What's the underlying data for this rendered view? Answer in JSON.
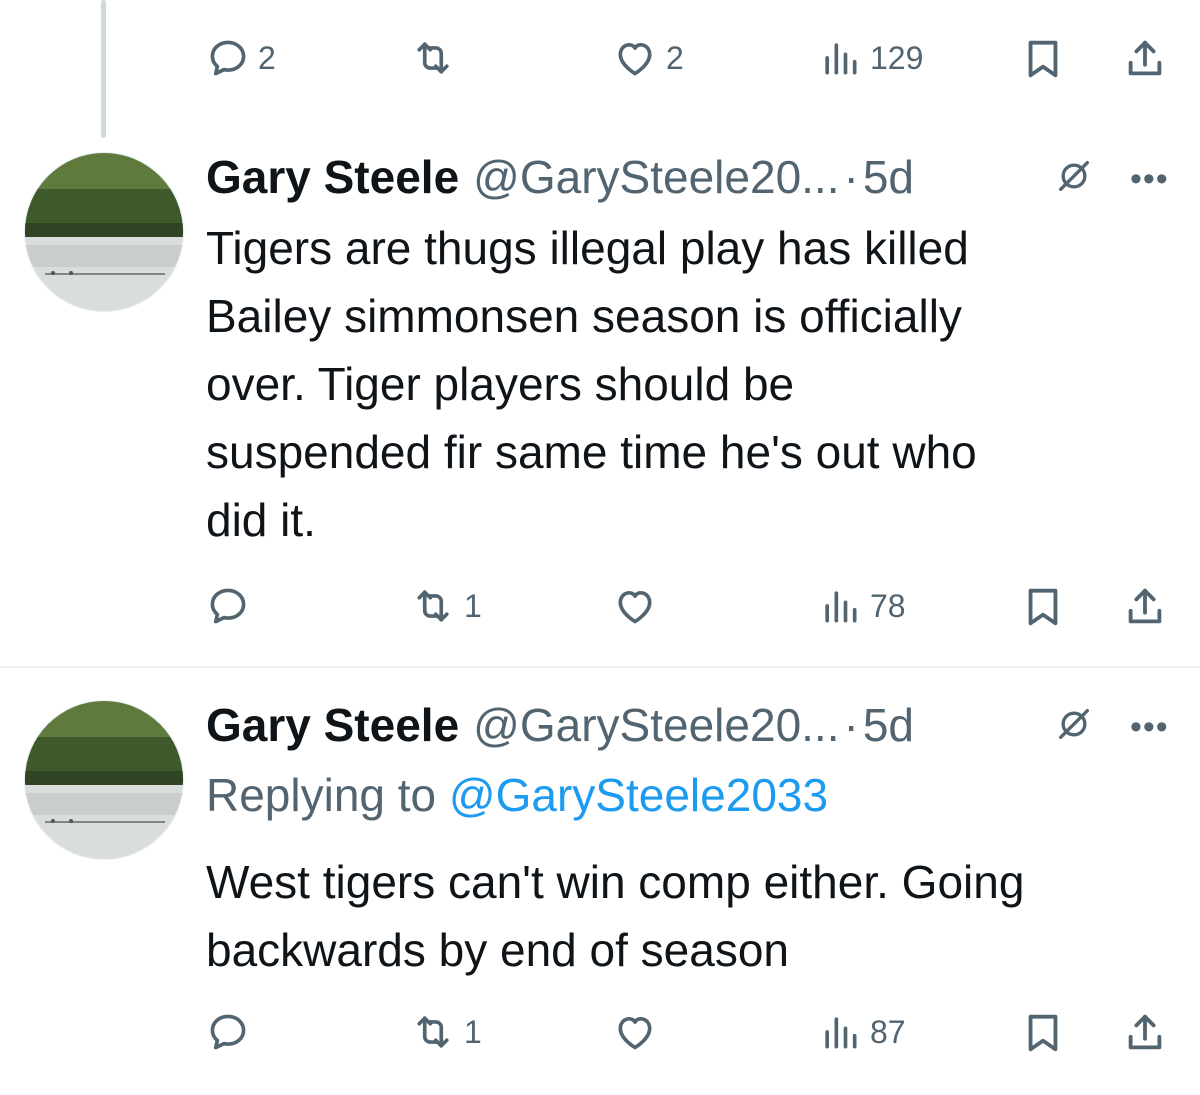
{
  "top_actions": {
    "replies": "2",
    "reposts": "",
    "likes": "2",
    "views": "129"
  },
  "tweets": [
    {
      "name": "Gary Steele",
      "handle": "@GarySteele20...",
      "separator": "·",
      "time": "5d",
      "replying_prefix": "",
      "replying_handle": "",
      "lines": [
        "Tigers are thugs illegal play has killed",
        "Bailey  simmonsen season is officially",
        "over. Tiger players should  be",
        "suspended  fir same time he's out who",
        "did it."
      ],
      "actions": {
        "replies": "",
        "reposts": "1",
        "likes": "",
        "views": "78"
      }
    },
    {
      "name": "Gary Steele",
      "handle": "@GarySteele20...",
      "separator": "·",
      "time": "5d",
      "replying_prefix": "Replying to ",
      "replying_handle": "@GarySteele2033",
      "lines": [
        "West tigers can't win comp either.  Going",
        "backwards  by end of season"
      ],
      "actions": {
        "replies": "",
        "reposts": "1",
        "likes": "",
        "views": "87"
      }
    }
  ],
  "icons": {
    "reply": "reply-icon",
    "repost": "repost-icon",
    "like": "heart-icon",
    "views": "views-icon",
    "bookmark": "bookmark-icon",
    "share": "share-icon",
    "grok": "grok-icon",
    "more": "more-icon"
  }
}
